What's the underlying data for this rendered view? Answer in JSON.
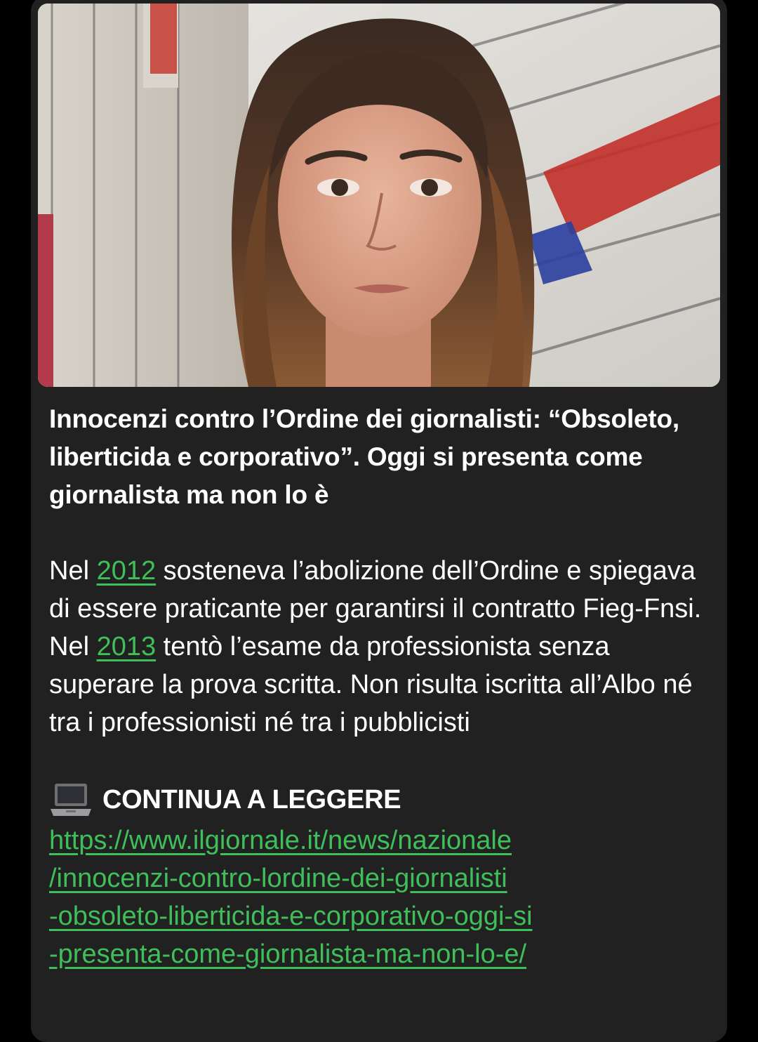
{
  "message": {
    "image_alt": "woman in front of newspaper wall",
    "title": "Innocenzi contro l’Ordine dei giornalisti: “Obsoleto, liberticida e corporativo”. Oggi si presenta come giornalista ma non lo è",
    "body": {
      "part1": "Nel ",
      "link1": "2012",
      "part2": " sosteneva l’abolizione dell’Ordine e spiegava di essere praticante per garantirsi il contratto Fieg-Fnsi. Nel ",
      "link2": "2013",
      "part3": " tentò l’esame da professionista senza superare la prova scritta. Non risulta iscritta all’Albo né tra i professionisti né tra i pubblicisti"
    },
    "cta_icon": "laptop-icon",
    "cta_label": "CONTINUA A LEGGERE",
    "url_lines": [
      "https://www.ilgiornale.it/news/nazionale",
      "/innocenzi-contro-lordine-dei-giornalisti",
      "-obsoleto-liberticida-e-corporativo-oggi-si",
      "-presenta-come-giornalista-ma-non-lo-e/"
    ]
  },
  "colors": {
    "background": "#000000",
    "bubble": "#212121",
    "text": "#ffffff",
    "link": "#3fbf5a"
  }
}
